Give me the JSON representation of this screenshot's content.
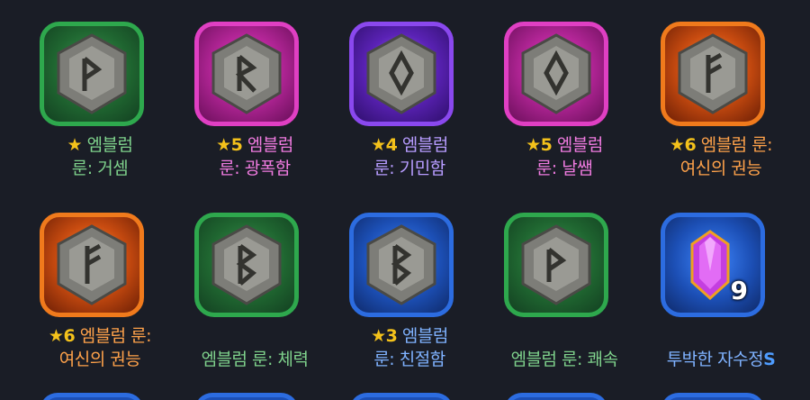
{
  "items": [
    {
      "stars": "★",
      "line1": " 엠블럼",
      "line2": "룬: 거셈",
      "color": "green",
      "rune": "P"
    },
    {
      "stars": "★5",
      "line1": " 엠블럼",
      "line2": "룬: 광폭함",
      "color": "pink",
      "rune": "R"
    },
    {
      "stars": "★4",
      "line1": " 엠블럼",
      "line2": "룬: 기민함",
      "color": "purple",
      "rune": "diamond"
    },
    {
      "stars": "★5",
      "line1": " 엠블럼",
      "line2": "룬: 날쌤",
      "color": "pink",
      "rune": "diamond"
    },
    {
      "stars": "★6",
      "line1": " 엠블럼 룬:",
      "line2": "여신의 권능",
      "color": "orange",
      "rune": "F"
    },
    {
      "stars": "★6",
      "line1": " 엠블럼 룬:",
      "line2": "여신의 권능",
      "color": "orange",
      "rune": "F"
    },
    {
      "stars": "",
      "line1": "",
      "line2": "엠블럼 룬: 체력",
      "color": "green",
      "rune": "B"
    },
    {
      "stars": "★3",
      "line1": " 엠블럼",
      "line2": "룬: 친절함",
      "color": "blue",
      "rune": "B"
    },
    {
      "stars": "",
      "line1": "",
      "line2": "엠블럼 룬: 쾌속",
      "color": "green",
      "rune": "P"
    },
    {
      "stars": "",
      "line1": "",
      "line2": "투박한 자수정",
      "grade": "S",
      "color": "blue",
      "rune": "gem",
      "count": "9"
    }
  ]
}
